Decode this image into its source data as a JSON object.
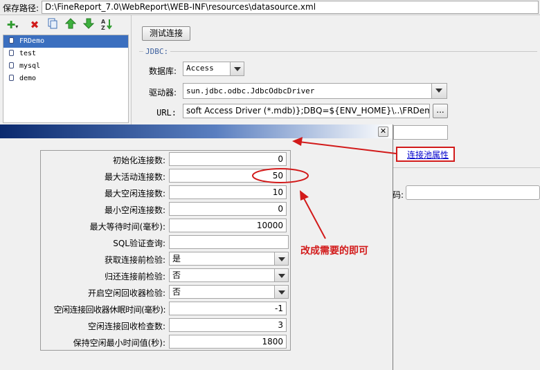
{
  "header": {
    "path_label": "保存路径:",
    "path_value": "D:\\FineReport_7.0\\WebReport\\WEB-INF\\resources\\datasource.xml"
  },
  "toolbar": {
    "icons": [
      "add-icon",
      "delete-icon",
      "copy-icon",
      "move-up-icon",
      "move-down-icon",
      "sort-icon"
    ]
  },
  "tree": {
    "items": [
      "FRDemo",
      "test",
      "mysql",
      "demo"
    ],
    "selected": "FRDemo"
  },
  "right_panel": {
    "test_button": "测试连接",
    "group_title": "JDBC:",
    "database_label": "数据库:",
    "database_value": "Access",
    "driver_label": "驱动器:",
    "driver_value": "sun.jdbc.odbc.JdbcOdbcDriver",
    "url_label": "URL:",
    "url_value": "soft Access Driver (*.mdb)};DBQ=${ENV_HOME}\\..\\FRDemo.mdb",
    "browse_button": "...",
    "pool_link": "连接池属性",
    "password_label_fragment": "码:"
  },
  "dialog": {
    "close_button": "✕",
    "rows": [
      {
        "label": "初始化连接数:",
        "value": "0",
        "type": "spinner"
      },
      {
        "label": "最大活动连接数:",
        "value": "50",
        "type": "spinner"
      },
      {
        "label": "最大空闲连接数:",
        "value": "10",
        "type": "spinner"
      },
      {
        "label": "最小空闲连接数:",
        "value": "0",
        "type": "spinner"
      },
      {
        "label": "最大等待时间(毫秒):",
        "value": "10000",
        "type": "spinner"
      },
      {
        "label": "SQL验证查询:",
        "value": "",
        "type": "text"
      },
      {
        "label": "获取连接前检验:",
        "value": "是",
        "type": "select"
      },
      {
        "label": "归还连接前检验:",
        "value": "否",
        "type": "select"
      },
      {
        "label": "开启空闲回收器检验:",
        "value": "否",
        "type": "select"
      },
      {
        "label": "空闲连接回收器休眠时间(毫秒):",
        "value": "-1",
        "type": "spinner"
      },
      {
        "label": "空闲连接回收检查数:",
        "value": "3",
        "type": "spinner"
      },
      {
        "label": "保持空闲最小时间值(秒):",
        "value": "1800",
        "type": "spinner"
      }
    ]
  },
  "annotation": {
    "text": "改成需要的即可",
    "color": "#d21a1a"
  },
  "colors": {
    "selection": "#3b6fbf",
    "dialog_title_start": "#0b2a6e",
    "dialog_title_end": "#ffffff",
    "link": "#0000cc",
    "annotation": "#d21a1a"
  }
}
